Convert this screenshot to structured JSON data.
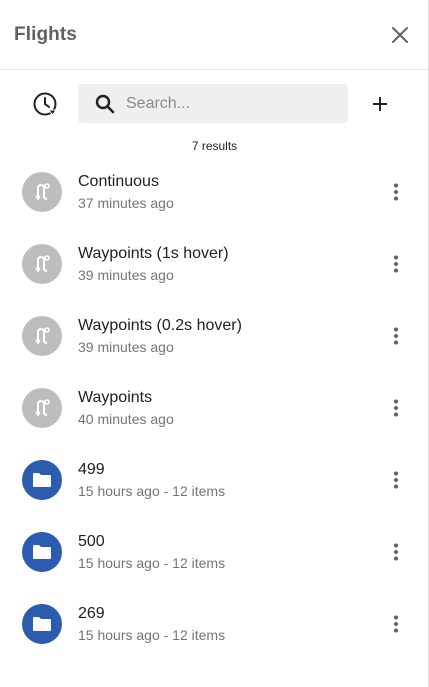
{
  "header": {
    "title": "Flights"
  },
  "search": {
    "placeholder": "Search..."
  },
  "results": {
    "count_label": "7 results"
  },
  "colors": {
    "folder": "#2b5cb0",
    "route": "#bdbdbd"
  },
  "items": [
    {
      "title": "Continuous",
      "subtitle": "37 minutes ago",
      "kind": "route-icon"
    },
    {
      "title": "Waypoints (1s hover)",
      "subtitle": "39 minutes ago",
      "kind": "route-icon"
    },
    {
      "title": "Waypoints (0.2s hover)",
      "subtitle": "39 minutes ago",
      "kind": "route-icon"
    },
    {
      "title": "Waypoints",
      "subtitle": "40 minutes ago",
      "kind": "route-icon"
    },
    {
      "title": "499",
      "subtitle": "15 hours ago - 12 items",
      "kind": "folder-icon"
    },
    {
      "title": "500",
      "subtitle": "15 hours ago - 12 items",
      "kind": "folder-icon"
    },
    {
      "title": "269",
      "subtitle": "15 hours ago - 12 items",
      "kind": "folder-icon"
    }
  ]
}
